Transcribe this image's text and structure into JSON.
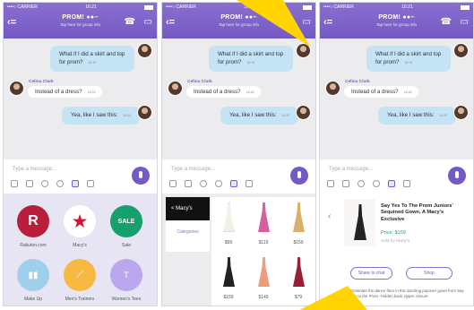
{
  "status": {
    "carrier": "••••○ CARRIER",
    "time": "16:21"
  },
  "chat": {
    "title": "PROM! ●●–",
    "subtitle": "Tap here for group info",
    "message_1": "What if I did a skirt and top for prom?",
    "message_1_time": "16:15",
    "sender": "Celina Clark",
    "message_2": "Instead of a dress?",
    "message_2_time": "16:18",
    "message_3": "Yea, like I saw this:",
    "message_3_time": "16:20",
    "composer_placeholder": "Type a message..."
  },
  "apps": [
    {
      "name": "Rakuten.com",
      "glyph": "R"
    },
    {
      "name": "Macy's",
      "glyph": "★"
    },
    {
      "name": "Sale",
      "glyph": "SALE"
    },
    {
      "name": "Make Up",
      "glyph": "▮▮"
    },
    {
      "name": "Men's Trainers",
      "glyph": "⟋"
    },
    {
      "name": "Women's Tees",
      "glyph": "T"
    }
  ],
  "macys": {
    "back_label": "< Macy's",
    "categories_label": "Categories",
    "prices": [
      "$99",
      "$119",
      "$159",
      "$149",
      "$79"
    ]
  },
  "product": {
    "title": "Say Yes To The Prom Juniors' Sequined Gown, A Macy's Exclusive",
    "price_label": "Price:",
    "price_value": "$159",
    "sold_by": "Sold by Macy's",
    "share_button": "Share to chat",
    "shop_button": "Shop",
    "description": "Dominate the dance floor in this dazzling popover gown from Say Yes to the Prom\n-Hidden back zipper closure"
  },
  "colors": {
    "viber_purple": "#7559c7",
    "bubble_blue": "#c4e3f4",
    "macy_red": "#db0f2e",
    "highlight_yellow": "#ffd400"
  }
}
